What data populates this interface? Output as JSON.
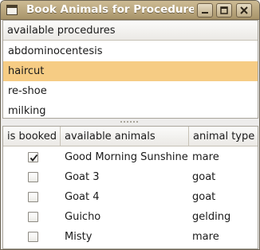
{
  "window": {
    "title": "Book Animals for Procedure"
  },
  "procedures": {
    "header": "available procedures",
    "items": [
      "abdominocentesis",
      "haircut",
      "re-shoe",
      "milking"
    ],
    "selected_index": 1
  },
  "animals": {
    "columns": {
      "booked": "is booked",
      "name": "available animals",
      "type": "animal type"
    },
    "rows": [
      {
        "booked": true,
        "name": "Good Morning Sunshine",
        "type": "mare"
      },
      {
        "booked": false,
        "name": "Goat 3",
        "type": "goat"
      },
      {
        "booked": false,
        "name": "Goat 4",
        "type": "goat"
      },
      {
        "booked": false,
        "name": "Guicho",
        "type": "gelding"
      },
      {
        "booked": false,
        "name": "Misty",
        "type": "mare"
      }
    ]
  },
  "colors": {
    "selection": "#f6cc84",
    "titlebar": "#b8a57c"
  },
  "icons": {
    "window": "window-icon",
    "minimize": "minimize-icon",
    "maximize": "maximize-icon",
    "close": "close-icon",
    "check": "check-icon",
    "pane_grip": "grip-icon"
  }
}
